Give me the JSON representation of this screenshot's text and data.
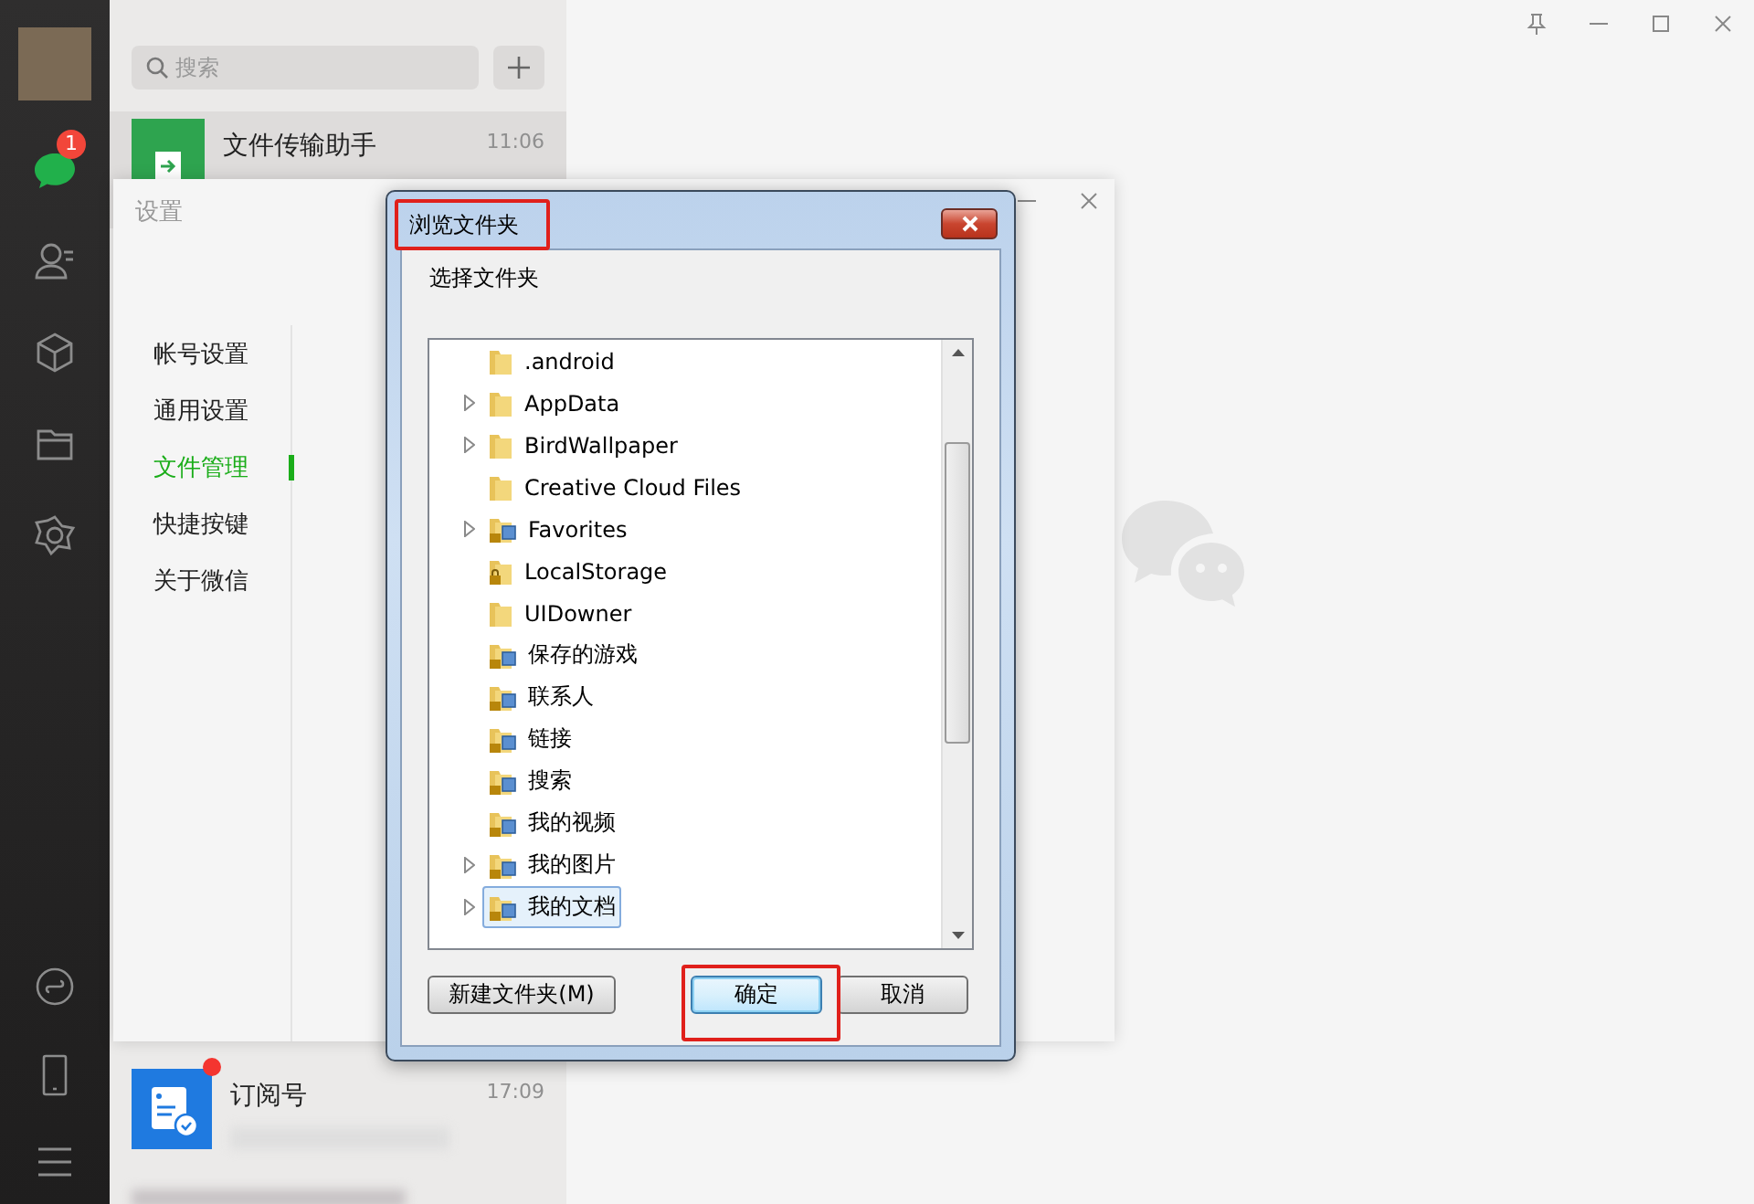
{
  "sidebar": {
    "unread_badge": "1"
  },
  "chat_list": {
    "search": {
      "placeholder": "搜索"
    },
    "top_chats": [
      {
        "name": "文件传输助手",
        "time": "11:06",
        "selected": true,
        "unread": false,
        "kind": "file"
      }
    ],
    "bottom_chats": [
      {
        "name": "订阅号",
        "time": "17:09",
        "selected": false,
        "unread": true,
        "kind": "subscription"
      }
    ]
  },
  "settings": {
    "title": "设置",
    "menu": [
      {
        "label": "帐号设置",
        "selected": false
      },
      {
        "label": "通用设置",
        "selected": false
      },
      {
        "label": "文件管理",
        "selected": true
      },
      {
        "label": "快捷按键",
        "selected": false
      },
      {
        "label": "关于微信",
        "selected": false
      }
    ]
  },
  "dialog": {
    "title": "浏览文件夹",
    "prompt": "选择文件夹",
    "tree": [
      {
        "label": ".android",
        "expandable": false,
        "kind": "folder",
        "selected": false
      },
      {
        "label": "AppData",
        "expandable": true,
        "kind": "folder",
        "selected": false
      },
      {
        "label": "BirdWallpaper",
        "expandable": true,
        "kind": "folder",
        "selected": false
      },
      {
        "label": "Creative Cloud Files",
        "expandable": false,
        "kind": "folder",
        "selected": false
      },
      {
        "label": "Favorites",
        "expandable": true,
        "kind": "special",
        "selected": false
      },
      {
        "label": "LocalStorage",
        "expandable": false,
        "kind": "locked",
        "selected": false
      },
      {
        "label": "UIDowner",
        "expandable": false,
        "kind": "folder",
        "selected": false
      },
      {
        "label": "保存的游戏",
        "expandable": false,
        "kind": "special",
        "selected": false
      },
      {
        "label": "联系人",
        "expandable": false,
        "kind": "special",
        "selected": false
      },
      {
        "label": "链接",
        "expandable": false,
        "kind": "special",
        "selected": false
      },
      {
        "label": "搜索",
        "expandable": false,
        "kind": "special",
        "selected": false
      },
      {
        "label": "我的视频",
        "expandable": false,
        "kind": "special",
        "selected": false
      },
      {
        "label": "我的图片",
        "expandable": true,
        "kind": "special",
        "selected": false
      },
      {
        "label": "我的文档",
        "expandable": true,
        "kind": "special",
        "selected": true
      }
    ],
    "buttons": [
      {
        "label": "新建文件夹(M)",
        "default": false
      },
      {
        "label": "确定",
        "default": true
      },
      {
        "label": "取消",
        "default": false
      }
    ]
  }
}
